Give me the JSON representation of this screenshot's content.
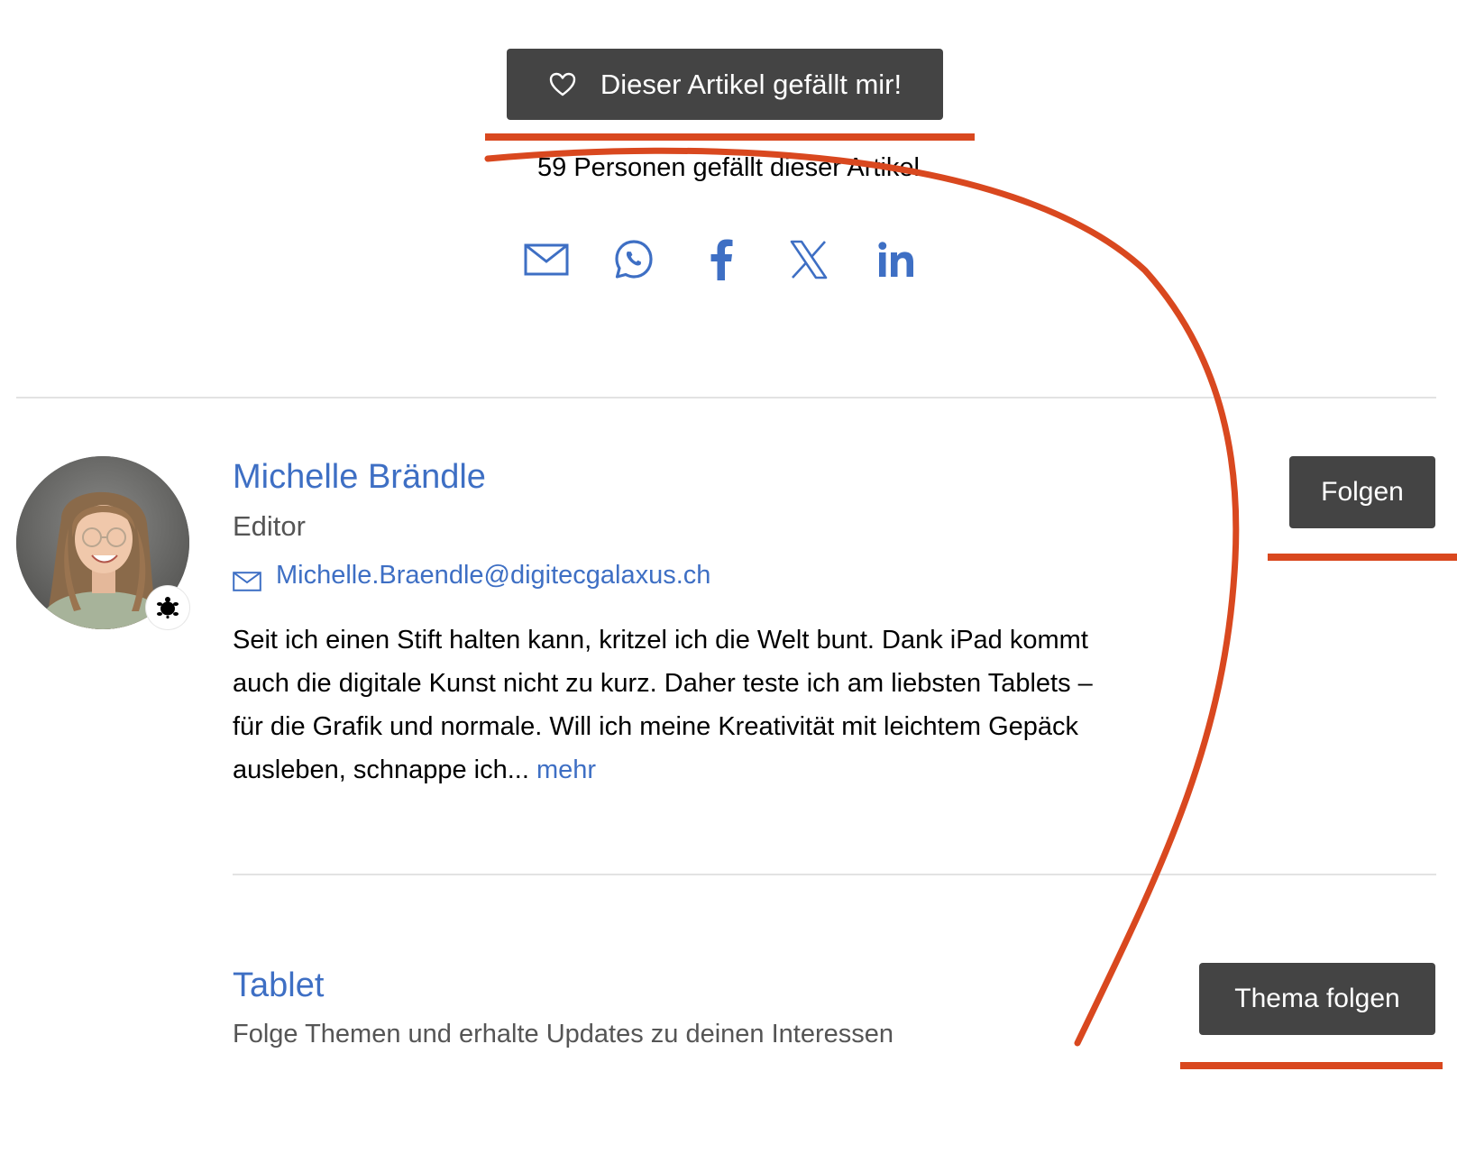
{
  "like": {
    "button_label": "Dieser Artikel gefällt mir!",
    "count_text": "59 Personen gefällt dieser Artikel"
  },
  "share": {
    "icons": [
      "mail-icon",
      "whatsapp-icon",
      "facebook-icon",
      "x-icon",
      "linkedin-icon"
    ],
    "color": "#3e6fc4"
  },
  "author": {
    "name": "Michelle Brändle",
    "role": "Editor",
    "email": "Michelle.Braendle@digitecgalaxus.ch",
    "bio": "Seit ich einen Stift halten kann, kritzel ich die Welt bunt. Dank iPad kommt auch die digitale Kunst nicht zu kurz. Daher teste ich am liebsten Tablets – für die Grafik und normale. Will ich meine Kreativität mit leichtem Gepäck ausleben, schnappe ich...",
    "more_label": "mehr",
    "follow_label": "Folgen",
    "badge_icon": "turtle-icon"
  },
  "topic": {
    "title": "Tablet",
    "description": "Folge Themen und erhalte Updates zu deinen Interessen",
    "follow_label": "Thema folgen"
  },
  "colors": {
    "button_bg": "#444444",
    "link": "#3e6fc4",
    "annotation": "#d9481f",
    "divider": "#e3e3e3"
  }
}
